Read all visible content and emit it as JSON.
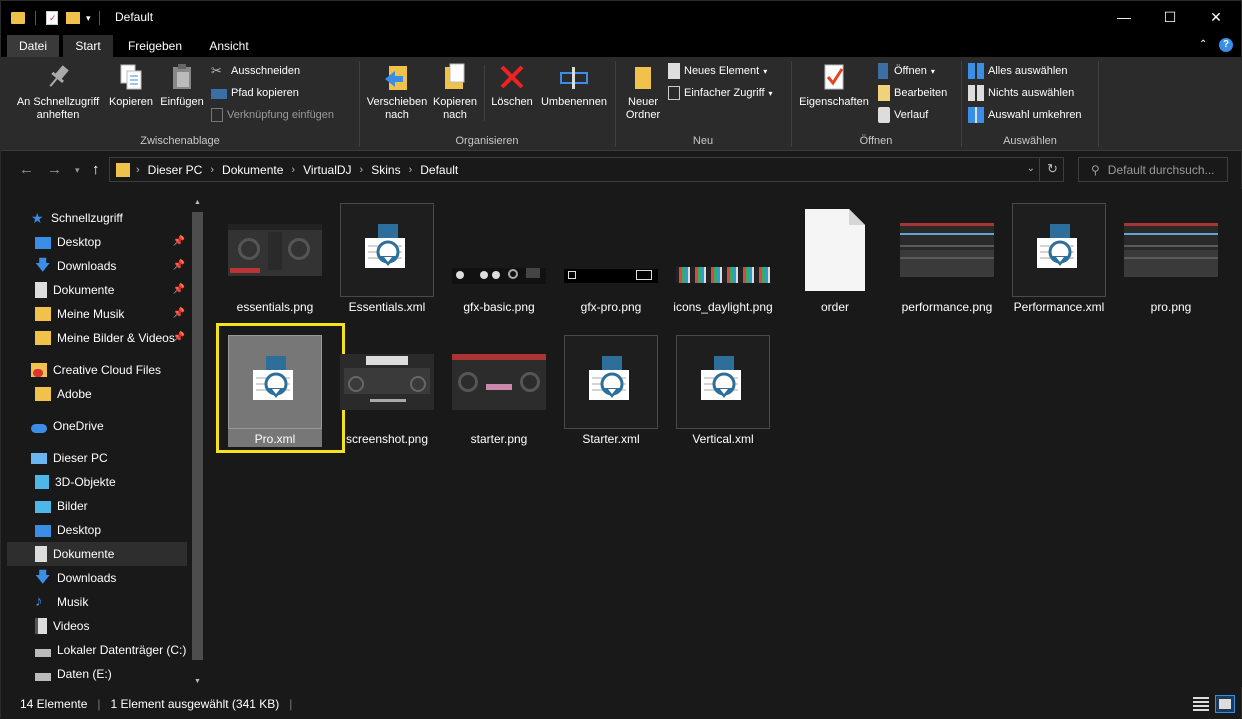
{
  "window": {
    "title": "Default",
    "minimize_glyph": "—",
    "maximize_glyph": "☐",
    "close_glyph": "✕"
  },
  "tabs": {
    "file": "Datei",
    "start": "Start",
    "share": "Freigeben",
    "view": "Ansicht"
  },
  "ribbon": {
    "clipboard": {
      "label": "Zwischenablage",
      "pin": "An Schnellzugriff anheften",
      "copy": "Kopieren",
      "paste": "Einfügen",
      "cut": "Ausschneiden",
      "copy_path": "Pfad kopieren",
      "paste_shortcut": "Verknüpfung einfügen"
    },
    "organize": {
      "label": "Organisieren",
      "move_to": "Verschieben nach",
      "copy_to": "Kopieren nach",
      "delete": "Löschen",
      "rename": "Umbenennen"
    },
    "new": {
      "label": "Neu",
      "new_folder": "Neuer Ordner",
      "new_item": "Neues Element",
      "easy_access": "Einfacher Zugriff"
    },
    "open": {
      "label": "Öffnen",
      "properties": "Eigenschaften",
      "open": "Öffnen",
      "edit": "Bearbeiten",
      "history": "Verlauf"
    },
    "select": {
      "label": "Auswählen",
      "select_all": "Alles auswählen",
      "select_none": "Nichts auswählen",
      "invert": "Auswahl umkehren"
    }
  },
  "address": {
    "crumbs": [
      "Dieser PC",
      "Dokumente",
      "VirtualDJ",
      "Skins",
      "Default"
    ],
    "search_placeholder": "Default durchsuch..."
  },
  "nav": {
    "items": [
      {
        "label": "Schnellzugriff",
        "icon": "star-icon"
      },
      {
        "label": "Desktop",
        "icon": "desktop-icon",
        "pinned": true
      },
      {
        "label": "Downloads",
        "icon": "download-icon",
        "pinned": true
      },
      {
        "label": "Dokumente",
        "icon": "document-icon",
        "pinned": true
      },
      {
        "label": "Meine Musik",
        "icon": "folder-icon",
        "pinned": true
      },
      {
        "label": "Meine Bilder & Videos",
        "icon": "folder-icon",
        "pinned": true
      },
      {
        "label": "Creative Cloud Files",
        "icon": "creative-cloud-icon"
      },
      {
        "label": "Adobe",
        "icon": "folder-icon"
      },
      {
        "label": "OneDrive",
        "icon": "cloud-icon"
      },
      {
        "label": "Dieser PC",
        "icon": "computer-icon"
      },
      {
        "label": "3D-Objekte",
        "icon": "cube-icon"
      },
      {
        "label": "Bilder",
        "icon": "pictures-icon"
      },
      {
        "label": "Desktop",
        "icon": "desktop-icon"
      },
      {
        "label": "Dokumente",
        "icon": "document-icon",
        "selected": true
      },
      {
        "label": "Downloads",
        "icon": "download-icon"
      },
      {
        "label": "Musik",
        "icon": "music-icon"
      },
      {
        "label": "Videos",
        "icon": "video-icon"
      },
      {
        "label": "Lokaler Datenträger (C:)",
        "icon": "drive-icon"
      },
      {
        "label": "Daten (E:)",
        "icon": "drive-icon"
      }
    ]
  },
  "files": [
    {
      "name": "essentials.png",
      "kind": "png"
    },
    {
      "name": "Essentials.xml",
      "kind": "xml"
    },
    {
      "name": "gfx-basic.png",
      "kind": "png"
    },
    {
      "name": "gfx-pro.png",
      "kind": "png"
    },
    {
      "name": "icons_daylight.png",
      "kind": "png"
    },
    {
      "name": "order",
      "kind": "blank"
    },
    {
      "name": "performance.png",
      "kind": "png"
    },
    {
      "name": "Performance.xml",
      "kind": "xml"
    },
    {
      "name": "pro.png",
      "kind": "png"
    },
    {
      "name": "Pro.xml",
      "kind": "xml",
      "selected": true
    },
    {
      "name": "screenshot.png",
      "kind": "png"
    },
    {
      "name": "starter.png",
      "kind": "png"
    },
    {
      "name": "Starter.xml",
      "kind": "xml"
    },
    {
      "name": "Vertical.xml",
      "kind": "xml"
    }
  ],
  "status": {
    "count": "14 Elemente",
    "selection": "1 Element ausgewählt (341 KB)"
  },
  "colors": {
    "selection_highlight": "#f4e21e",
    "folder": "#f0c24b",
    "accent_blue": "#3a8ee6"
  }
}
